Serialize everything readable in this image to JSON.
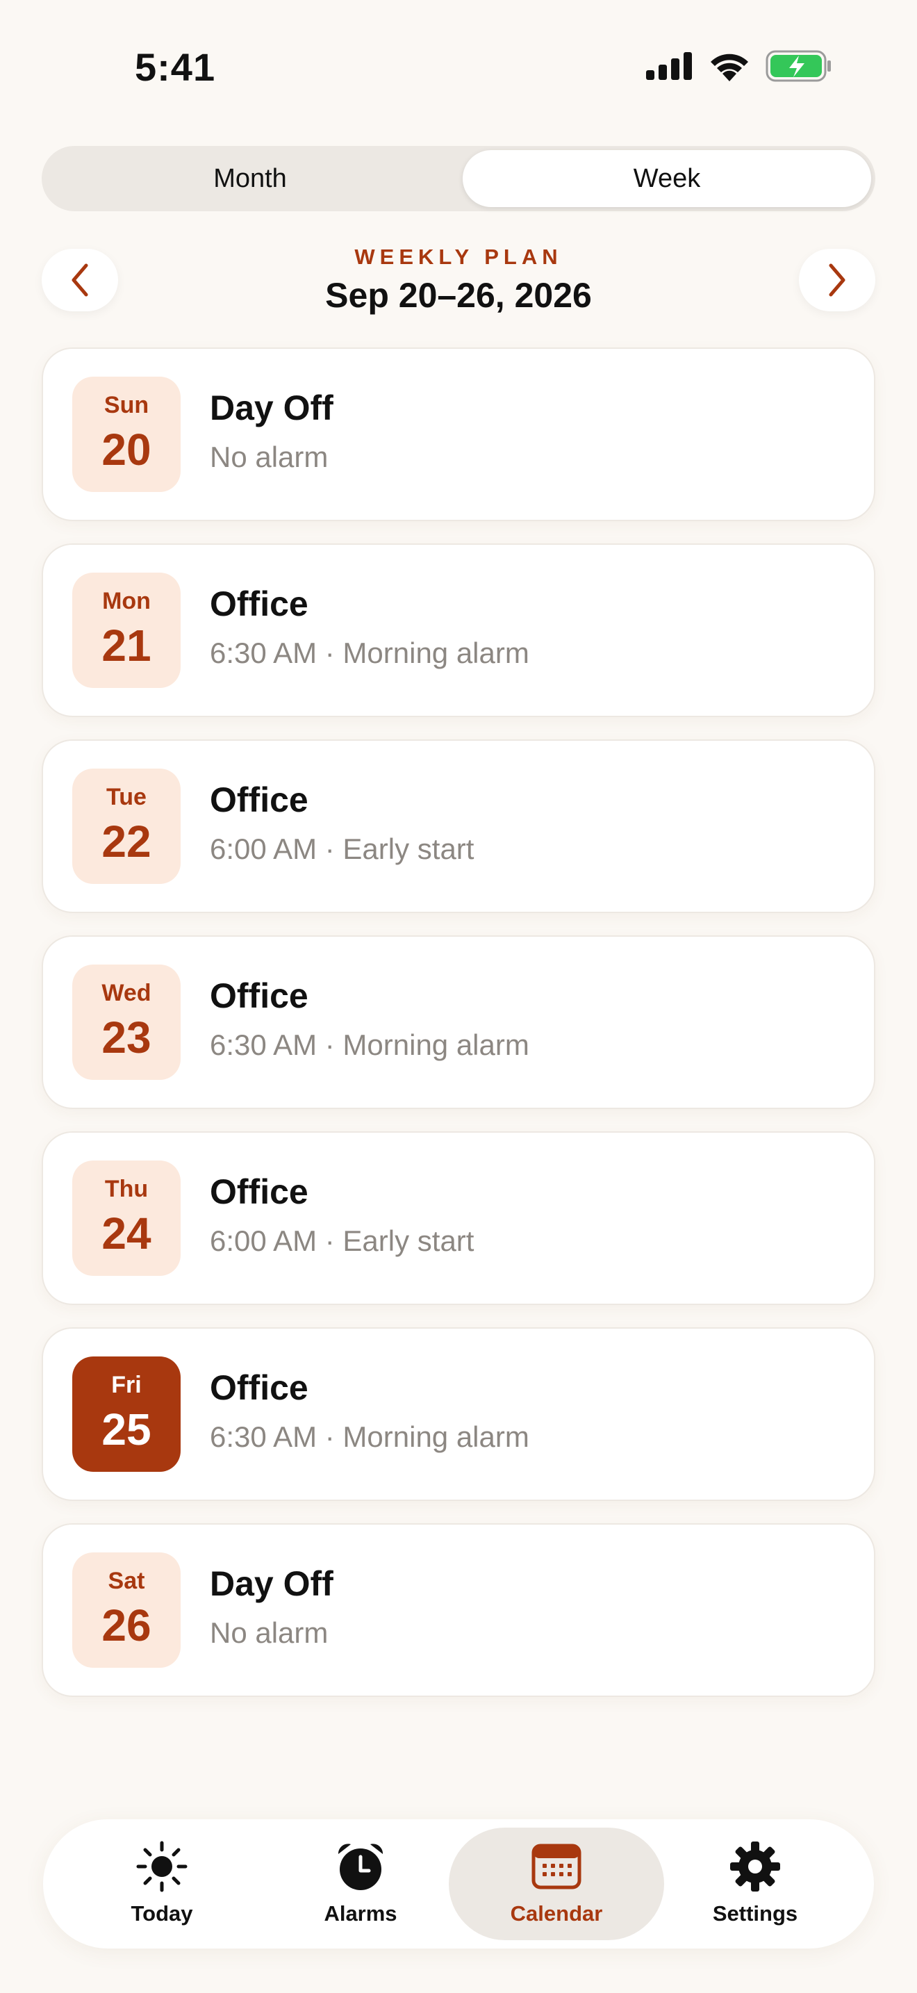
{
  "status": {
    "time": "5:41"
  },
  "view_toggle": {
    "month_label": "Month",
    "week_label": "Week",
    "selected": "Week"
  },
  "header": {
    "eyebrow": "WEEKLY PLAN",
    "range": "Sep 20–26, 2026"
  },
  "days": [
    {
      "dow": "Sun",
      "day": "20",
      "title": "Day Off",
      "subtitle": "No alarm",
      "selected": false
    },
    {
      "dow": "Mon",
      "day": "21",
      "title": "Office",
      "subtitle": "6:30 AM · Morning alarm",
      "selected": false
    },
    {
      "dow": "Tue",
      "day": "22",
      "title": "Office",
      "subtitle": "6:00 AM · Early start",
      "selected": false
    },
    {
      "dow": "Wed",
      "day": "23",
      "title": "Office",
      "subtitle": "6:30 AM · Morning alarm",
      "selected": false
    },
    {
      "dow": "Thu",
      "day": "24",
      "title": "Office",
      "subtitle": "6:00 AM · Early start",
      "selected": false
    },
    {
      "dow": "Fri",
      "day": "25",
      "title": "Office",
      "subtitle": "6:30 AM · Morning alarm",
      "selected": true
    },
    {
      "dow": "Sat",
      "day": "26",
      "title": "Day Off",
      "subtitle": "No alarm",
      "selected": false
    }
  ],
  "tabs": [
    {
      "label": "Today",
      "icon": "sun-icon",
      "active": false
    },
    {
      "label": "Alarms",
      "icon": "alarm-clock-icon",
      "active": false
    },
    {
      "label": "Calendar",
      "icon": "calendar-icon",
      "active": true
    },
    {
      "label": "Settings",
      "icon": "gear-icon",
      "active": false
    }
  ],
  "colors": {
    "accent": "#A8380F",
    "badge_bg": "#FCE9DD",
    "background": "#FBF8F4",
    "battery": "#34C759"
  }
}
